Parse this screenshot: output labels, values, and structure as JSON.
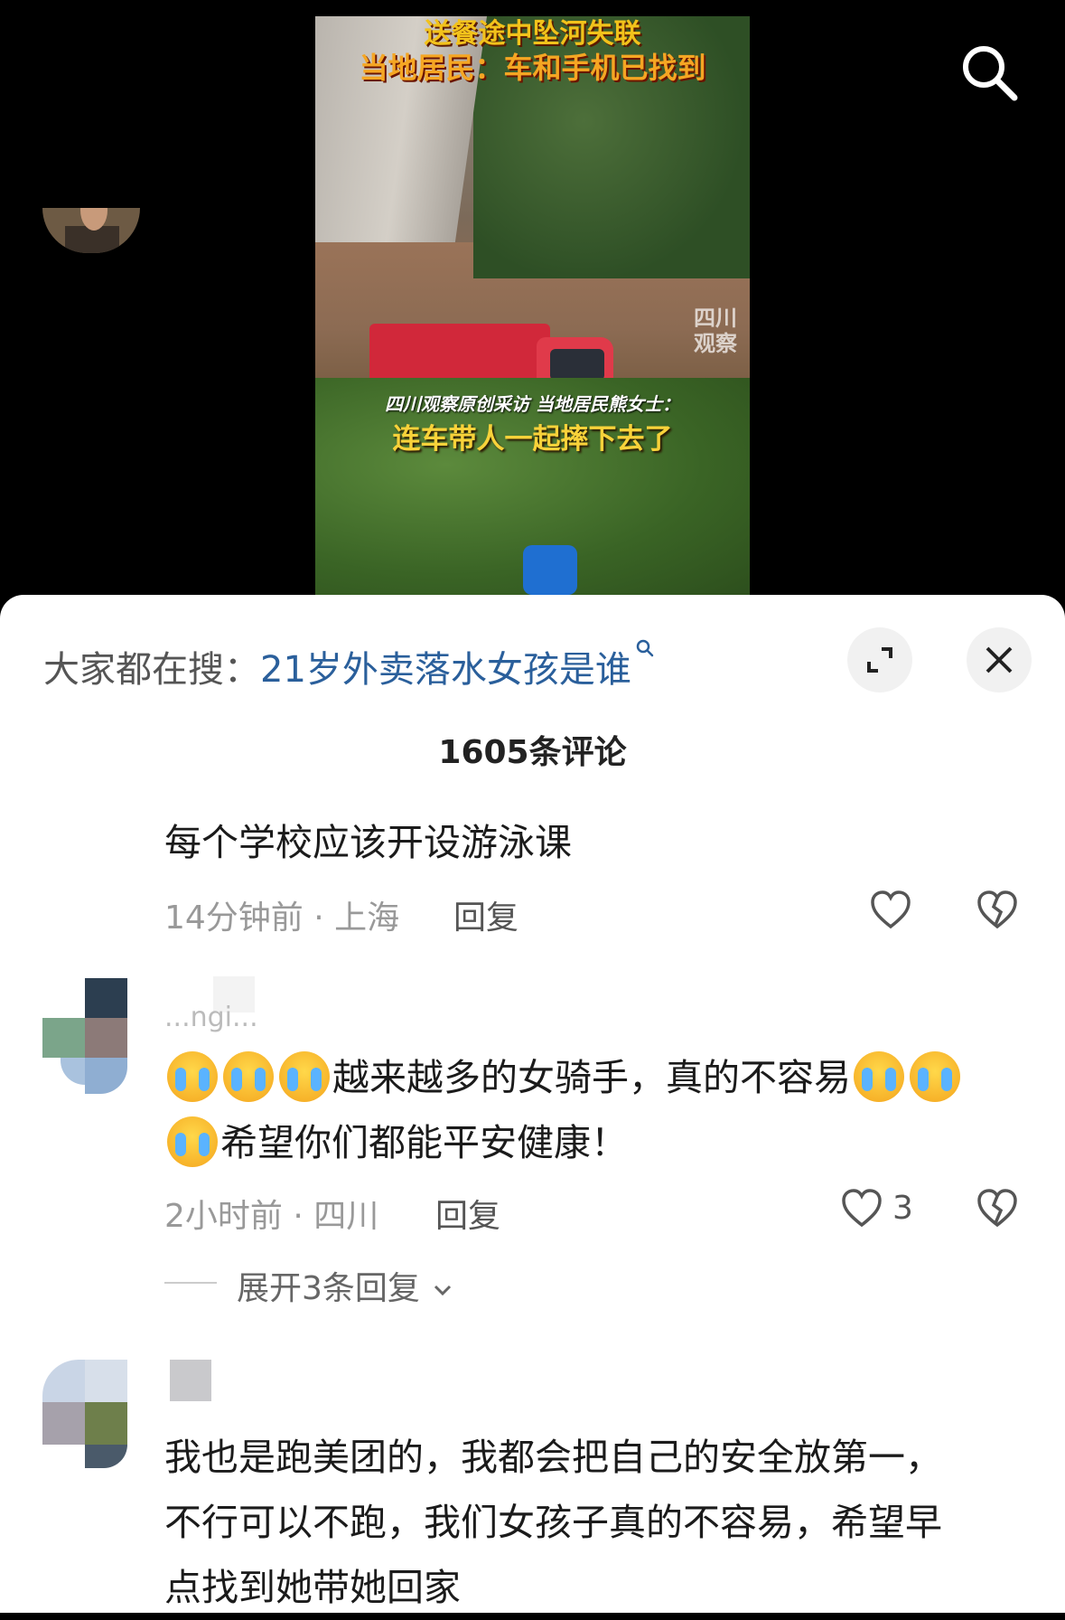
{
  "video": {
    "caption_line1": "送餐途中坠河失联",
    "caption_line2": "当地居民：车和手机已找到",
    "caption_line3": "四川观察原创采访 当地居民熊女士：",
    "caption_line4": "连车带人一起摔下去了",
    "watermark": "四川观察"
  },
  "trending": {
    "prefix": "大家都在搜：",
    "keyword": "21岁外卖落水女孩是谁"
  },
  "comment_count": "1605条评论",
  "comments": [
    {
      "text": "每个学校应该开设游泳课",
      "time_location": "14分钟前 · 上海",
      "reply_label": "回复"
    },
    {
      "username": "...ngi...",
      "text_line1": "越来越多的女骑手，真的不容易",
      "text_line2": "希望你们都能平安健康！",
      "time_location": "2小时前 · 四川",
      "reply_label": "回复",
      "likes": "3",
      "expand_replies": "展开3条回复"
    },
    {
      "text_line1": "我也是跑美团的，我都会把自己的安全放第一，",
      "text_line2": "不行可以不跑，我们女孩子真的不容易，希望早",
      "text_line3": "点找到她带她回家"
    }
  ],
  "colors": {
    "keyword": "#2a5f9b",
    "sheet_bg": "#ffffff",
    "meta_gray": "#999999"
  },
  "icons": [
    "search-icon",
    "expand-icon",
    "close-icon",
    "heart-icon",
    "dislike-heart-icon",
    "chevron-down-icon",
    "crying-emoji-icon"
  ]
}
